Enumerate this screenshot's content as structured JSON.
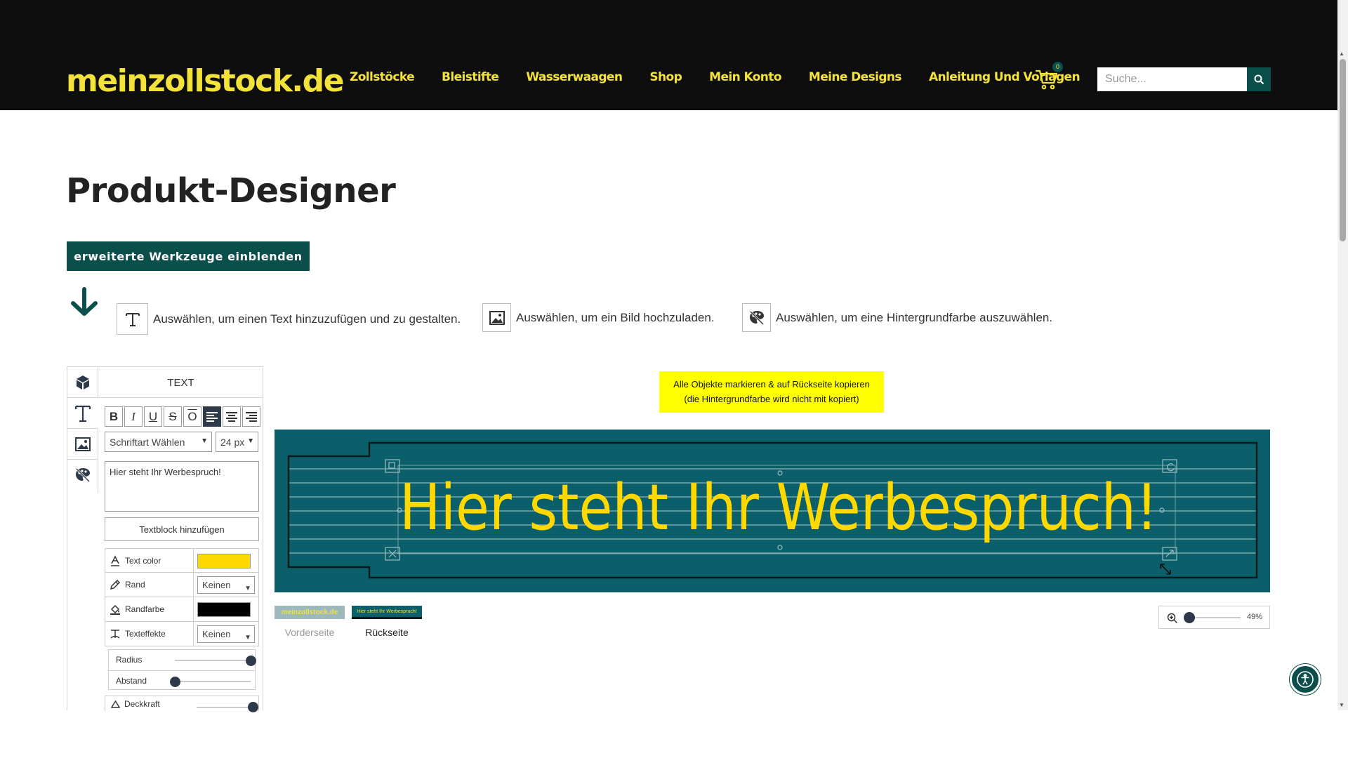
{
  "header": {
    "logo": "meinzollstock.de",
    "nav": [
      "Zollstöcke",
      "Bleistifte",
      "Wasserwaagen",
      "Shop",
      "Mein Konto",
      "Meine Designs",
      "Anleitung Und Vorlagen"
    ],
    "cart_count": "0",
    "search_placeholder": "Suche..."
  },
  "page": {
    "title": "Produkt-Designer",
    "advanced_button": "erweiterte Werkzeuge einblenden"
  },
  "hints": [
    "Auswählen, um einen Text hinzuzufügen und zu gestalten.",
    "Auswählen, um ein Bild hochzuladen.",
    "Auswählen, um eine Hintergrundfarbe auszuwählen."
  ],
  "panel": {
    "heading": "TEXT",
    "format_buttons": [
      "B",
      "I",
      "U",
      "S",
      "O"
    ],
    "font_select": "Schriftart Wählen",
    "size_select": "24 px",
    "text_value": "Hier steht Ihr Werbespruch!",
    "add_block": "Textblock hinzufügen",
    "props": {
      "text_color_label": "Text color",
      "text_color": "#ffd800",
      "rand_label": "Rand",
      "rand_value": "Keinen",
      "randfarbe_label": "Randfarbe",
      "randfarbe": "#000000",
      "effects_label": "Texteffekte",
      "effects_value": "Keinen"
    },
    "sliders": {
      "radius_label": "Radius",
      "radius_value": 1,
      "abstand_label": "Abstand",
      "abstand_value": 0,
      "opacity_label": "Deckkraft",
      "opacity_value": 1
    }
  },
  "designer": {
    "copy_note_line1": "Alle Objekte markieren & auf Rückseite kopieren",
    "copy_note_line2": "(die Hintergrundfarbe wird nicht mit kopiert)",
    "canvas_text": "Hier steht Ihr Werbespruch!",
    "canvas_bg": "#0b5f6b",
    "text_color": "#ffd800",
    "thumb_front_text": "meinzollstock.de",
    "thumb_back_text": "Hier steht Ihr Werbespruch!",
    "front_label": "Vorderseite",
    "back_label": "Rückseite",
    "zoom": "49%",
    "zoom_fraction": 0.05
  },
  "colors": {
    "brand_yellow": "#f2e23a",
    "brand_green": "#0b4f4c",
    "header_bg": "#0e0e0e"
  }
}
